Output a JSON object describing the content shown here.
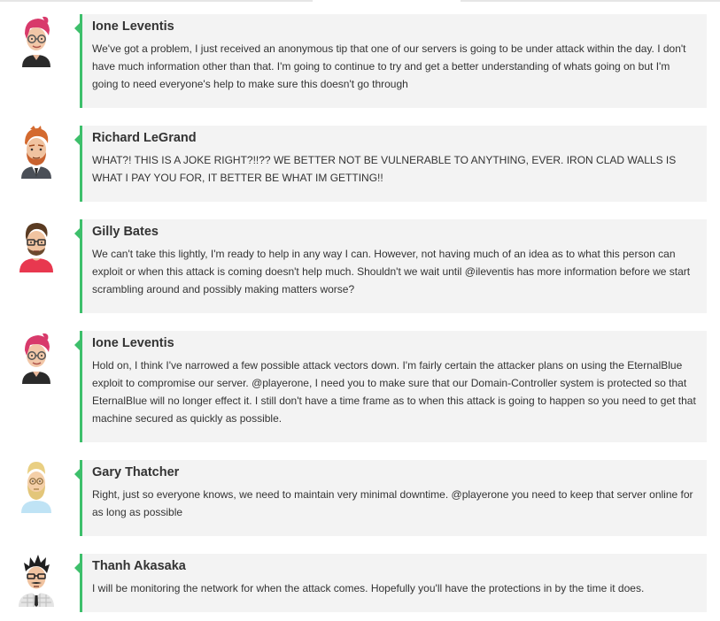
{
  "messages": [
    {
      "author": "Ione Leventis",
      "avatar": "pink-hair-woman-glasses-avatar-icon",
      "text": "We've got a problem, I just received an anonymous tip that one of our servers is going to be under attack within the day. I don't have much information other than that. I'm going to continue to try and get a better understanding of whats going on but I'm going to need everyone's help to make sure this doesn't go through"
    },
    {
      "author": "Richard LeGrand",
      "avatar": "bearded-red-hair-man-avatar-icon",
      "text": "WHAT?! THIS IS A JOKE RIGHT?!!?? WE BETTER NOT BE VULNERABLE TO ANYTHING, EVER. IRON CLAD WALLS IS WHAT I PAY YOU FOR, IT BETTER BE WHAT IM GETTING!!"
    },
    {
      "author": "Gilly Bates",
      "avatar": "glasses-man-red-shirt-avatar-icon",
      "text": "We can't take this lightly, I'm ready to help in any way I can. However, not having much of an idea as to what this person can exploit or when this attack is coming doesn't help much. Shouldn't we wait until @ileventis has more information before we start scrambling around and possibly making matters worse?"
    },
    {
      "author": "Ione Leventis",
      "avatar": "pink-hair-woman-glasses-avatar-icon",
      "text": "Hold on, I think I've narrowed a few possible attack vectors down. I'm fairly certain the attacker plans on using the EternalBlue exploit to compromise our server. @playerone, I need you to make sure that our Domain-Controller system is protected so that EternalBlue will no longer effect it. I still don't have a time frame as to when this attack is going to happen so you need to get that machine secured as quickly as possible."
    },
    {
      "author": "Gary Thatcher",
      "avatar": "blond-bearded-man-avatar-icon",
      "text": "Right, just so everyone knows, we need to maintain very minimal downtime. @playerone you need to keep that server online for as long as possible"
    },
    {
      "author": "Thanh Akasaka",
      "avatar": "spiky-hair-man-tie-avatar-icon",
      "text": "I will be monitoring the network for when the attack comes. Hopefully you'll have the protections in by the time it does."
    }
  ],
  "colors": {
    "accent": "#3dbf6b",
    "bubble_bg": "#f3f3f3",
    "text": "#333333"
  }
}
